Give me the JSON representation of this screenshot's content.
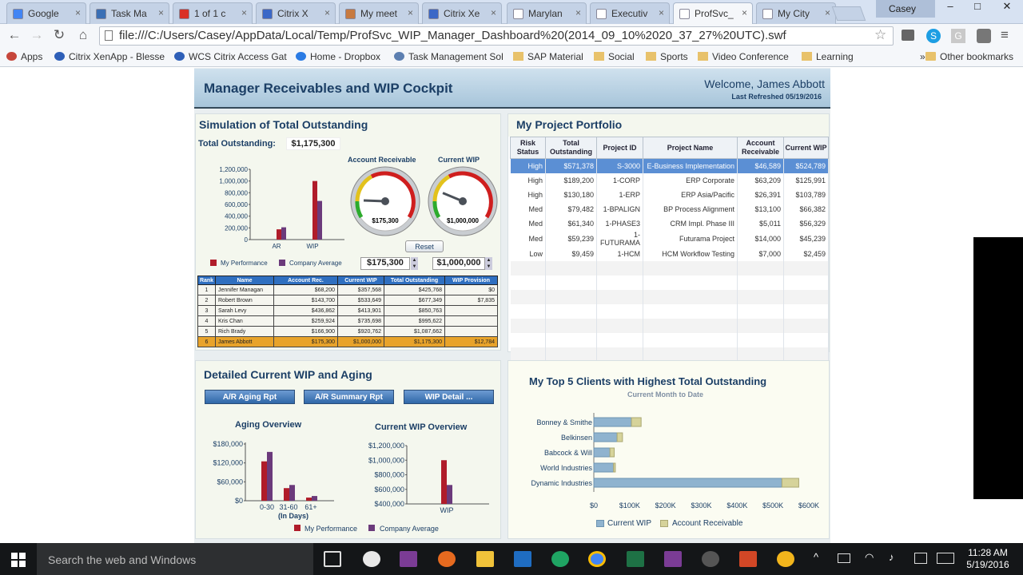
{
  "browser": {
    "tabs": [
      {
        "label": "Google",
        "icon_color": "#4285f4"
      },
      {
        "label": "Task Ma",
        "icon_color": "#3a6fb5"
      },
      {
        "label": "1 of 1 c",
        "icon_color": "#d93025"
      },
      {
        "label": "Citrix X",
        "icon_color": "#3b68c7"
      },
      {
        "label": "My meet",
        "icon_color": "#c77a40"
      },
      {
        "label": "Citrix Xe",
        "icon_color": "#3b68c7"
      },
      {
        "label": "Marylan",
        "icon_color": "#ffffff"
      },
      {
        "label": "Executiv",
        "icon_color": "#ffffff"
      },
      {
        "label": "ProfSvc_",
        "icon_color": "#ffffff"
      },
      {
        "label": "My City",
        "icon_color": "#ffffff"
      }
    ],
    "user": "Casey",
    "window_controls": [
      "–",
      "□",
      "✕"
    ],
    "address": "file:///C:/Users/Casey/AppData/Local/Temp/ProfSvc_WIP_Manager_Dashboard%20(2014_09_10%2020_37_27%20UTC).swf",
    "nav_icons": [
      "back-icon",
      "forward-icon",
      "reload-icon",
      "home-icon"
    ],
    "bookmarks": [
      {
        "label": "Apps",
        "icon": "apps-grid-icon"
      },
      {
        "label": "Citrix XenApp - Blesse",
        "icon": "citrix-icon"
      },
      {
        "label": "WCS Citrix Access Gat",
        "icon": "citrix-icon"
      },
      {
        "label": "Home - Dropbox",
        "icon": "dropbox-icon"
      },
      {
        "label": "Task Management Sol",
        "icon": "task-icon"
      },
      {
        "label": "SAP Material",
        "icon": "folder-icon"
      },
      {
        "label": "Social",
        "icon": "folder-icon"
      },
      {
        "label": "Sports",
        "icon": "folder-icon"
      },
      {
        "label": "Video Conference",
        "icon": "folder-icon"
      },
      {
        "label": "Learning",
        "icon": "folder-icon"
      }
    ],
    "more": "»",
    "other_bookmarks": "Other bookmarks"
  },
  "dashboard": {
    "title": "Manager Receivables and WIP Cockpit",
    "welcome": "Welcome, James Abbott",
    "refreshed": "Last Refreshed 05/19/2016",
    "simulation": {
      "title": "Simulation of Total Outstanding",
      "total_label": "Total Outstanding:",
      "total_value": "$1,175,300",
      "gauge_ar_label": "Account Receivable",
      "gauge_ar_value": "$175,300",
      "gauge_ar_fraction": 0.175,
      "gauge_wip_label": "Current WIP",
      "gauge_wip_value": "$1,000,000",
      "gauge_wip_fraction": 0.25,
      "reset": "Reset",
      "input_ar": "$175,300",
      "input_wip": "$1,000,000",
      "legend_mine": "My Performance",
      "legend_company": "Company Average",
      "rank_headers": [
        "Rank",
        "Name",
        "Account Rec.",
        "Current WIP",
        "Total Outstanding",
        "WIP Provision"
      ],
      "rank_rows": [
        [
          "1",
          "Jennifer Managan",
          "$68,200",
          "$357,568",
          "$425,768",
          "$0"
        ],
        [
          "2",
          "Robert Brown",
          "$143,700",
          "$533,649",
          "$677,349",
          "$7,835"
        ],
        [
          "3",
          "Sarah Levy",
          "$436,862",
          "$413,901",
          "$850,763",
          ""
        ],
        [
          "4",
          "Kris Chan",
          "$259,924",
          "$735,698",
          "$995,622",
          ""
        ],
        [
          "5",
          "Rich Brady",
          "$166,900",
          "$920,762",
          "$1,087,662",
          ""
        ],
        [
          "6",
          "James Abbott",
          "$175,300",
          "$1,000,000",
          "$1,175,300",
          "$12,784"
        ]
      ]
    },
    "portfolio": {
      "title": "My Project Portfolio",
      "headers": [
        "Risk Status",
        "Total Outstanding",
        "Project ID",
        "Project Name",
        "Account Receivable",
        "Current WIP"
      ],
      "rows": [
        [
          "High",
          "$571,378",
          "S-3000",
          "E-Business Implementation",
          "$46,589",
          "$524,789"
        ],
        [
          "High",
          "$189,200",
          "1-CORP",
          "ERP Corporate",
          "$63,209",
          "$125,991"
        ],
        [
          "High",
          "$130,180",
          "1-ERP",
          "ERP Asia/Pacific",
          "$26,391",
          "$103,789"
        ],
        [
          "Med",
          "$79,482",
          "1-BPALIGN",
          "BP Process Alignment",
          "$13,100",
          "$66,382"
        ],
        [
          "Med",
          "$61,340",
          "1-PHASE3",
          "CRM Impl. Phase III",
          "$5,011",
          "$56,329"
        ],
        [
          "Med",
          "$59,239",
          "1-FUTURAMA",
          "Futurama Project",
          "$14,000",
          "$45,239"
        ],
        [
          "Low",
          "$9,459",
          "1-HCM",
          "HCM Workflow Testing",
          "$7,000",
          "$2,459"
        ]
      ]
    },
    "wip_aging": {
      "title": "Detailed Current WIP and Aging",
      "buttons": [
        "A/R Aging Rpt",
        "A/R Summary Rpt",
        "WIP Detail ..."
      ],
      "aging_title": "Aging Overview",
      "wip_title": "Current WIP Overview",
      "aging_xlabel": "(In Days)",
      "legend_mine": "My Performance",
      "legend_company": "Company Average"
    },
    "top_clients": {
      "title": "My Top 5 Clients with Highest Total Outstanding",
      "subtitle": "Current Month to Date",
      "legend_wip": "Current WIP",
      "legend_ar": "Account Receivable"
    }
  },
  "chart_data": [
    {
      "type": "bar",
      "categories": [
        "AR",
        "WIP"
      ],
      "series": [
        {
          "name": "My Performance",
          "values": [
            175300,
            1000000
          ]
        },
        {
          "name": "Company Average",
          "values": [
            210000,
            660000
          ]
        }
      ],
      "yticks": [
        "1,200,000",
        "1,000,000",
        "800,000",
        "600,000",
        "400,000",
        "200,000",
        "0"
      ],
      "ylim": [
        0,
        1200000
      ]
    },
    {
      "type": "bar",
      "categories": [
        "0-30",
        "31-60",
        "61+"
      ],
      "series": [
        {
          "name": "My Performance",
          "values": [
            125000,
            40000,
            10000
          ]
        },
        {
          "name": "Company Average",
          "values": [
            155000,
            50000,
            15000
          ]
        }
      ],
      "yticks": [
        "$180,000",
        "$120,000",
        "$60,000",
        "$0"
      ],
      "ylim": [
        0,
        180000
      ]
    },
    {
      "type": "bar",
      "categories": [
        "WIP"
      ],
      "series": [
        {
          "name": "My Performance",
          "values": [
            1000000
          ]
        },
        {
          "name": "Company Average",
          "values": [
            660000
          ]
        }
      ],
      "yticks": [
        "$1,200,000",
        "$1,000,000",
        "$800,000",
        "$600,000",
        "$400,000"
      ],
      "ylim": [
        400000,
        1200000
      ]
    },
    {
      "type": "bar",
      "orientation": "horizontal",
      "stacked": true,
      "categories": [
        "Bonney & Smithe",
        "Belkinsen",
        "Babcock & Will",
        "World Industries",
        "Dynamic Industries"
      ],
      "series": [
        {
          "name": "Current WIP",
          "values": [
            105000,
            65000,
            45000,
            55000,
            525000
          ]
        },
        {
          "name": "Account Receivable",
          "values": [
            27000,
            15000,
            12000,
            5000,
            47000
          ]
        }
      ],
      "xticks": [
        "$0",
        "$100K",
        "$200K",
        "$300K",
        "$400K",
        "$500K",
        "$600K"
      ],
      "xlim": [
        0,
        600000
      ]
    }
  ],
  "taskbar": {
    "search_placeholder": "Search the web and Windows",
    "time": "11:28 AM",
    "date": "5/19/2016"
  }
}
